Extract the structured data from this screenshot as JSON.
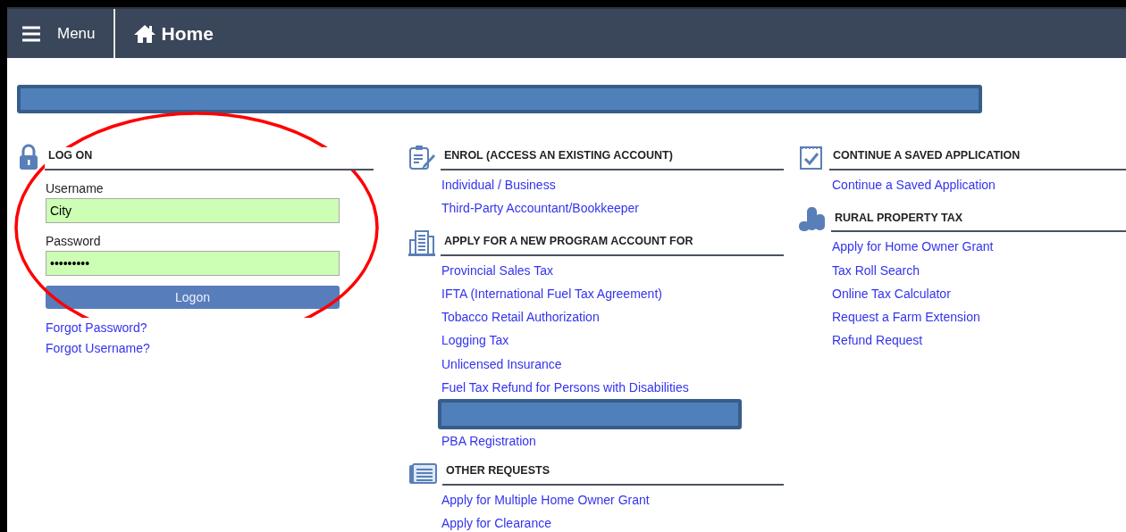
{
  "navbar": {
    "menu_label": "Menu",
    "title": "Home"
  },
  "banner": {
    "kind": "redacted"
  },
  "login": {
    "heading": "LOG ON",
    "username_label": "Username",
    "username_value": "City",
    "password_label": "Password",
    "password_value": "•••••••••",
    "button": "Logon",
    "links": [
      "Forgot Password?",
      "Forgot Username?"
    ]
  },
  "annotation": {
    "kind": "ellipse"
  },
  "columns": [
    [
      {
        "heading": "ENROL (ACCESS AN EXISTING ACCOUNT)",
        "links": [
          {
            "kind": "link",
            "text": "Individual / Business"
          },
          {
            "kind": "link",
            "text": "Third-Party Accountant/Bookkeeper"
          }
        ]
      },
      {
        "heading": "APPLY FOR A NEW PROGRAM ACCOUNT FOR",
        "links": [
          {
            "kind": "link",
            "text": "Provincial Sales Tax"
          },
          {
            "kind": "link",
            "text": "IFTA (International Fuel Tax Agreement)"
          },
          {
            "kind": "link",
            "text": "Tobacco Retail Authorization"
          },
          {
            "kind": "link",
            "text": "Logging Tax"
          },
          {
            "kind": "link",
            "text": "Unlicensed Insurance"
          },
          {
            "kind": "link",
            "text": "Fuel Tax Refund for Persons with Disabilities"
          },
          {
            "kind": "redacted"
          },
          {
            "kind": "link",
            "text": "PBA Registration"
          }
        ]
      },
      {
        "heading": "OTHER REQUESTS",
        "links": [
          {
            "kind": "link",
            "text": "Apply for Multiple Home Owner Grant"
          },
          {
            "kind": "link",
            "text": "Apply for Clearance"
          }
        ]
      }
    ],
    [
      {
        "heading": "CONTINUE A SAVED APPLICATION",
        "links": [
          {
            "kind": "link",
            "text": "Continue a Saved Application"
          }
        ]
      },
      {
        "heading": "RURAL PROPERTY TAX",
        "links": [
          {
            "kind": "link",
            "text": "Apply for Home Owner Grant"
          },
          {
            "kind": "link",
            "text": "Tax Roll Search"
          },
          {
            "kind": "link",
            "text": "Online Tax Calculator"
          },
          {
            "kind": "link",
            "text": "Request a Farm Extension"
          },
          {
            "kind": "link",
            "text": "Refund Request"
          }
        ]
      }
    ]
  ]
}
